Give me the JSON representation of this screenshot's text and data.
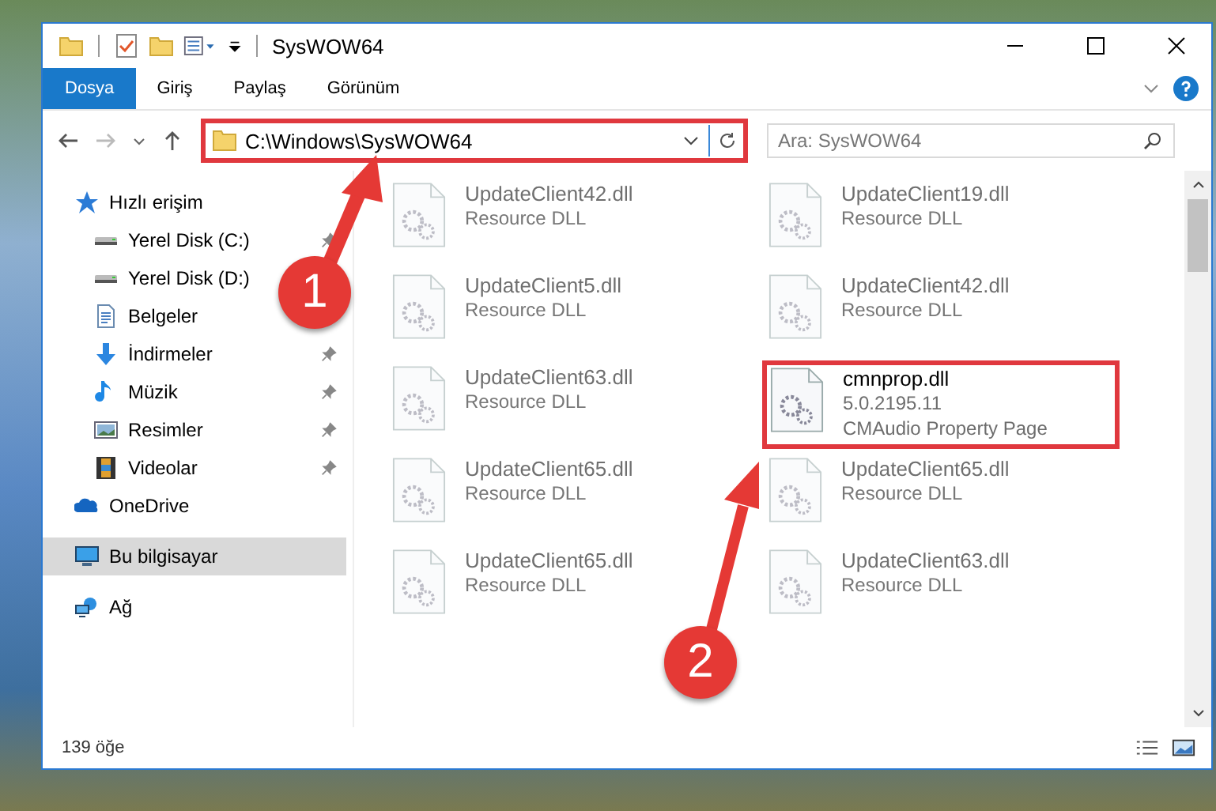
{
  "window": {
    "title": "SysWOW64"
  },
  "ribbon_tabs": [
    {
      "label": "Dosya",
      "selected": true
    },
    {
      "label": "Giriş",
      "selected": false
    },
    {
      "label": "Paylaş",
      "selected": false
    },
    {
      "label": "Görünüm",
      "selected": false
    }
  ],
  "address_bar": {
    "path": "C:\\Windows\\SysWOW64",
    "highlighted": true
  },
  "search": {
    "placeholder": "Ara: SysWOW64"
  },
  "sidebar": {
    "items": [
      {
        "label": "Hızlı erişim",
        "kind": "star",
        "selected": false,
        "children": [
          {
            "label": "Yerel Disk (C:)",
            "kind": "drive-c",
            "selected": false,
            "pinned": true
          },
          {
            "label": "Yerel Disk (D:)",
            "kind": "drive",
            "selected": false,
            "pinned": false
          },
          {
            "label": "Belgeler",
            "kind": "document",
            "selected": false,
            "pinned": false
          },
          {
            "label": "İndirmeler",
            "kind": "download",
            "selected": false,
            "pinned": true
          },
          {
            "label": "Müzik",
            "kind": "music",
            "selected": false,
            "pinned": true
          },
          {
            "label": "Resimler",
            "kind": "picture",
            "selected": false,
            "pinned": true
          },
          {
            "label": "Videolar",
            "kind": "video",
            "selected": false,
            "pinned": true
          }
        ]
      },
      {
        "label": "OneDrive",
        "kind": "cloud",
        "selected": false
      },
      {
        "label": "Bu bilgisayar",
        "kind": "computer",
        "selected": true
      },
      {
        "label": "Ağ",
        "kind": "network",
        "selected": false
      }
    ]
  },
  "files": [
    {
      "name": "UpdateClient42.dll",
      "details": [
        "Resource DLL"
      ],
      "blurred": true,
      "highlighted": false
    },
    {
      "name": "UpdateClient19.dll",
      "details": [
        "Resource DLL"
      ],
      "blurred": true,
      "highlighted": false
    },
    {
      "name": "UpdateClient5.dll",
      "details": [
        "Resource DLL"
      ],
      "blurred": true,
      "highlighted": false
    },
    {
      "name": "UpdateClient42.dll",
      "details": [
        "Resource DLL"
      ],
      "blurred": true,
      "highlighted": false
    },
    {
      "name": "UpdateClient63.dll",
      "details": [
        "Resource DLL"
      ],
      "blurred": true,
      "highlighted": false
    },
    {
      "name": "cmnprop.dll",
      "details": [
        "5.0.2195.11",
        "CMAudio Property Page"
      ],
      "blurred": false,
      "highlighted": true
    },
    {
      "name": "UpdateClient65.dll",
      "details": [
        "Resource DLL"
      ],
      "blurred": true,
      "highlighted": false
    },
    {
      "name": "UpdateClient65.dll",
      "details": [
        "Resource DLL"
      ],
      "blurred": true,
      "highlighted": false
    },
    {
      "name": "UpdateClient65.dll",
      "details": [
        "Resource DLL"
      ],
      "blurred": true,
      "highlighted": false
    },
    {
      "name": "UpdateClient63.dll",
      "details": [
        "Resource DLL"
      ],
      "blurred": true,
      "highlighted": false
    }
  ],
  "status_bar": {
    "count": "139 öğe"
  },
  "annotations": [
    {
      "label": "1"
    },
    {
      "label": "2"
    }
  ]
}
